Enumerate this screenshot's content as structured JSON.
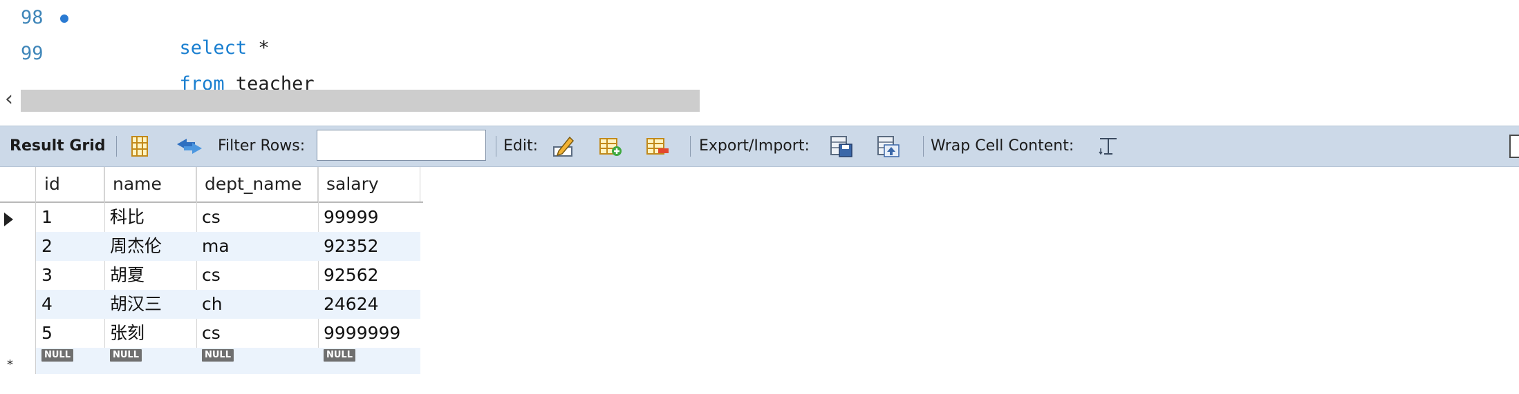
{
  "editor": {
    "lines": [
      {
        "number": "98",
        "keyword": "select",
        "rest": " *"
      },
      {
        "number": "99",
        "keyword": "from",
        "rest": " teacher"
      }
    ]
  },
  "toolbar": {
    "result_grid_label": "Result Grid",
    "filter_rows_label": "Filter Rows:",
    "filter_value": "",
    "edit_label": "Edit:",
    "export_import_label": "Export/Import:",
    "wrap_cell_label": "Wrap Cell Content:"
  },
  "grid": {
    "columns": [
      "id",
      "name",
      "dept_name",
      "salary"
    ],
    "rows": [
      [
        "1",
        "科比",
        "cs",
        "99999"
      ],
      [
        "2",
        "周杰伦",
        "ma",
        "92352"
      ],
      [
        "3",
        "胡夏",
        "cs",
        "92562"
      ],
      [
        "4",
        "胡汉三",
        "ch",
        "24624"
      ],
      [
        "5",
        "张刻",
        "cs",
        "9999999"
      ]
    ],
    "null_label": "NULL",
    "new_row_marker": "*"
  },
  "colors": {
    "toolbar_bg": "#ccd9e8",
    "keyword": "#1a7fd0",
    "alt_row": "#ebf3fc"
  }
}
